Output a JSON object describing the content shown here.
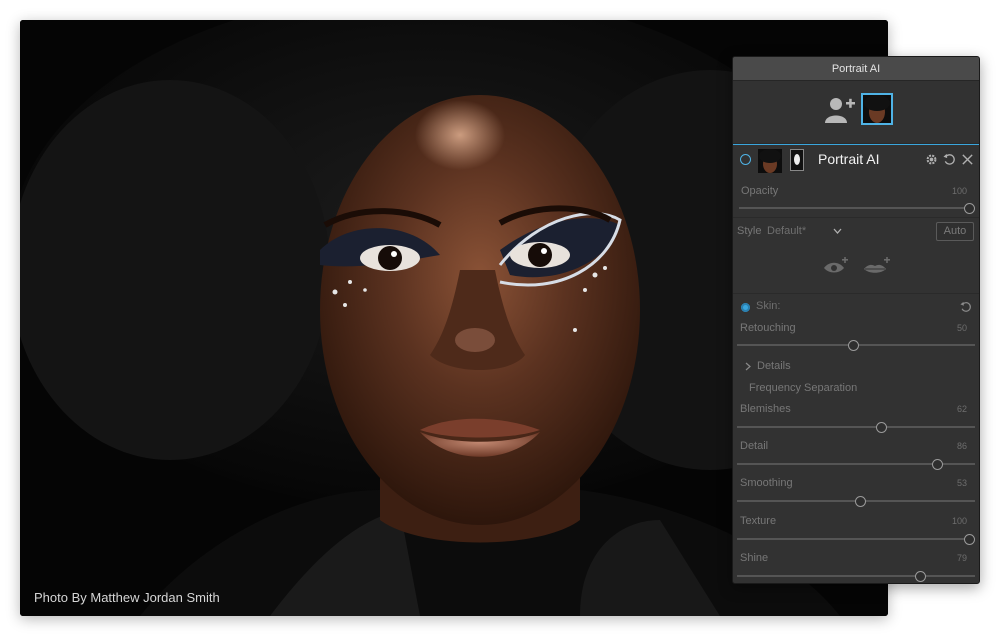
{
  "photo": {
    "credit": "Photo By Matthew Jordan Smith"
  },
  "panel": {
    "title": "Portrait AI",
    "layer_title": "Portrait AI",
    "opacity": {
      "label": "Opacity",
      "value": "100",
      "fraction": 1.0
    },
    "style": {
      "label": "Style",
      "selected": "Default*"
    },
    "auto_label": "Auto",
    "skin": {
      "section_label": "Skin:",
      "retouching": {
        "label": "Retouching",
        "value": "50",
        "fraction": 0.5
      },
      "details_label": "Details",
      "frequency_label": "Frequency Separation",
      "blemishes": {
        "label": "Blemishes",
        "value": "62",
        "fraction": 0.62
      },
      "detail": {
        "label": "Detail",
        "value": "86",
        "fraction": 0.86
      },
      "smoothing": {
        "label": "Smoothing",
        "value": "53",
        "fraction": 0.53
      },
      "texture": {
        "label": "Texture",
        "value": "100",
        "fraction": 1.0
      },
      "shine": {
        "label": "Shine",
        "value": "79",
        "fraction": 0.79
      }
    }
  },
  "colors": {
    "accent": "#3aa6dd",
    "panel_bg": "#323232",
    "titlebar_bg": "#4a4a4a"
  },
  "icons": [
    "add-person-icon",
    "settings-icon",
    "reset-icon",
    "close-icon",
    "eye-icon",
    "lips-icon",
    "chevron-down-icon",
    "chevron-right-icon",
    "reset-small-icon"
  ]
}
